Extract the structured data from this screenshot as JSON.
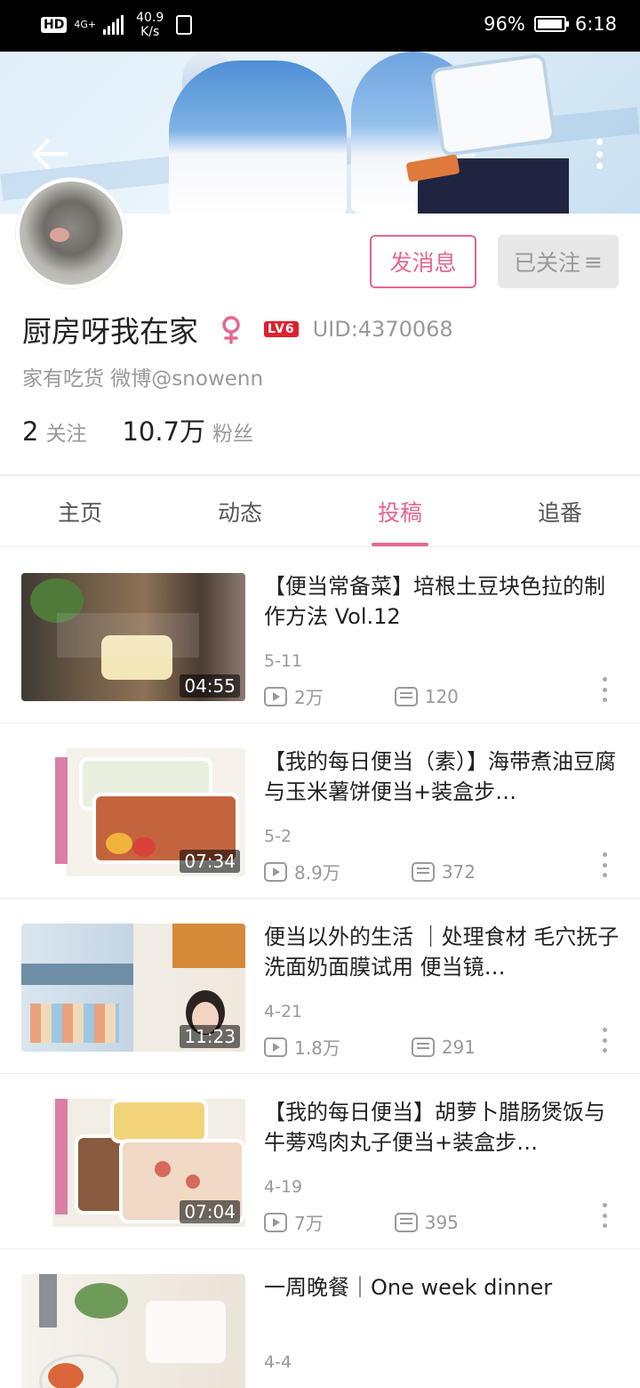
{
  "status_bar": {
    "hd": "HD",
    "network": "4G+",
    "speed_value": "40.9",
    "speed_unit": "K/s",
    "battery_percent": "96%",
    "time": "6:18"
  },
  "header": {
    "back_icon": "arrow-left-icon",
    "more_icon": "more-vertical-icon"
  },
  "actions": {
    "message_label": "发消息",
    "followed_label": "已关注",
    "followed_icon": "≡"
  },
  "profile": {
    "name": "厨房呀我在家",
    "gender_icon": "female-icon",
    "level": "LV6",
    "uid": "UID:4370068",
    "signature": "家有吃货 微博@snowenn",
    "following_count": "2",
    "following_label": "关注",
    "fans_count": "10.7万",
    "fans_label": "粉丝"
  },
  "tabs": [
    {
      "label": "主页"
    },
    {
      "label": "动态"
    },
    {
      "label": "投稿",
      "active": true
    },
    {
      "label": "追番"
    }
  ],
  "accent_color": "#e5668e",
  "videos": [
    {
      "title": "【便当常备菜】培根土豆块色拉的制作方法 Vol.12",
      "date": "5-11",
      "views": "2万",
      "comments": "120",
      "duration": "04:55"
    },
    {
      "title": "【我的每日便当（素）】海带煮油豆腐与玉米薯饼便当+装盒步…",
      "date": "5-2",
      "views": "8.9万",
      "comments": "372",
      "duration": "07:34"
    },
    {
      "title": "便当以外的生活 ｜处理食材 毛穴抚子洗面奶面膜试用 便当镜…",
      "date": "4-21",
      "views": "1.8万",
      "comments": "291",
      "duration": "11:23"
    },
    {
      "title": "【我的每日便当】胡萝卜腊肠煲饭与牛蒡鸡肉丸子便当+装盒步…",
      "date": "4-19",
      "views": "7万",
      "comments": "395",
      "duration": "07:04"
    },
    {
      "title": "一周晚餐｜One week dinner",
      "date": "4-4",
      "views": "",
      "comments": "",
      "duration": ""
    }
  ]
}
